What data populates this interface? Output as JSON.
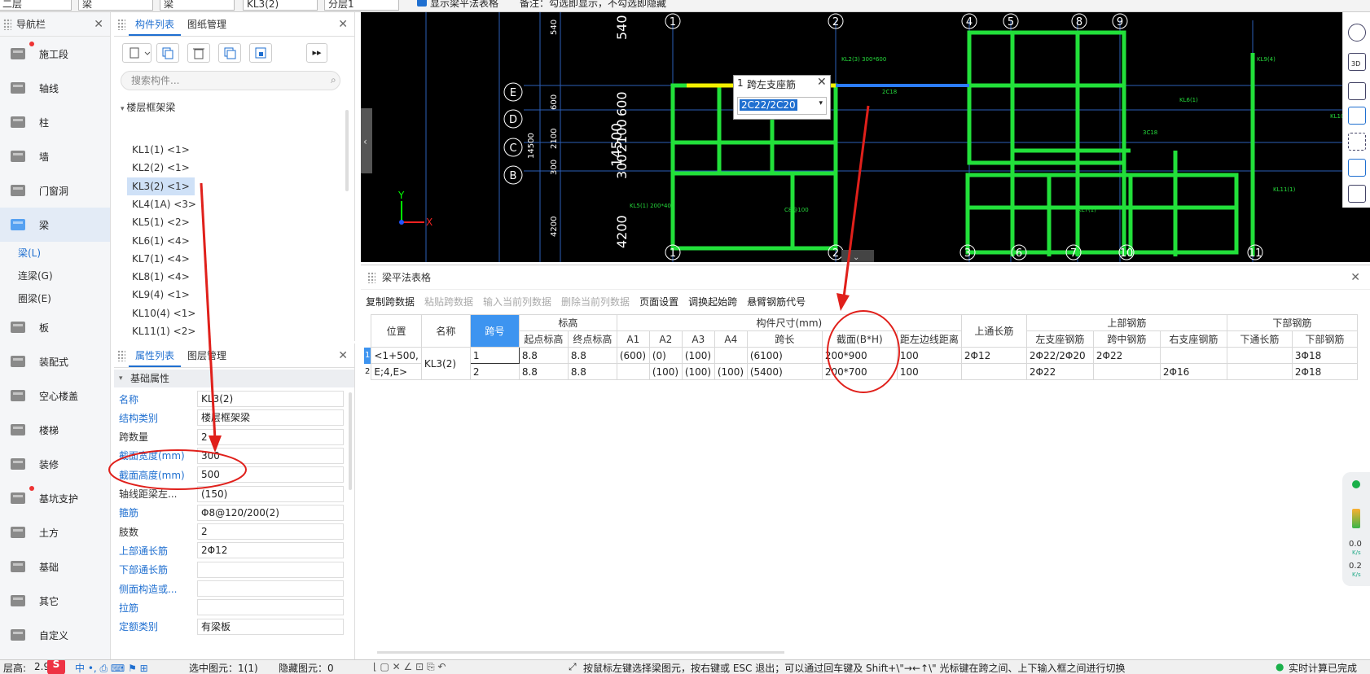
{
  "topbar": {
    "fields": [
      "二层",
      "梁",
      "梁",
      "KL3(2)",
      "分层1"
    ],
    "checkbox": "显示梁平法表格",
    "note": "备注：勾选即显示，不勾选即隐藏"
  },
  "nav": {
    "title": "导航栏",
    "items": [
      {
        "label": "施工段",
        "icon": "construction-icon"
      },
      {
        "label": "轴线",
        "icon": "grid-icon"
      },
      {
        "label": "柱",
        "icon": "column-icon"
      },
      {
        "label": "墙",
        "icon": "wall-icon"
      },
      {
        "label": "门窗洞",
        "icon": "door-window-icon"
      },
      {
        "label": "梁",
        "icon": "beam-icon"
      }
    ],
    "subitems": [
      "梁(L)",
      "连梁(G)",
      "圈梁(E)"
    ],
    "items2": [
      {
        "label": "板",
        "icon": "slab-icon"
      },
      {
        "label": "装配式",
        "icon": "prefab-icon"
      },
      {
        "label": "空心楼盖",
        "icon": "hollow-floor-icon"
      },
      {
        "label": "楼梯",
        "icon": "stairs-icon"
      },
      {
        "label": "装修",
        "icon": "decoration-icon"
      },
      {
        "label": "基坑支护",
        "icon": "pit-support-icon"
      },
      {
        "label": "土方",
        "icon": "earthwork-icon"
      },
      {
        "label": "基础",
        "icon": "foundation-icon"
      },
      {
        "label": "其它",
        "icon": "other-icon"
      },
      {
        "label": "自定义",
        "icon": "custom-icon"
      }
    ]
  },
  "complist": {
    "tabs": [
      "构件列表",
      "图纸管理"
    ],
    "search_placeholder": "搜索构件...",
    "root": "楼层框架梁",
    "items": [
      "KL1(1) <1>",
      "KL2(2) <1>",
      "KL3(2) <1>",
      "KL4(1A) <3>",
      "KL5(1) <2>",
      "KL6(1) <4>",
      "KL7(1) <4>",
      "KL8(1) <4>",
      "KL9(4) <1>",
      "KL10(4) <1>",
      "KL11(1) <2>"
    ]
  },
  "props": {
    "tabs": [
      "属性列表",
      "图层管理"
    ],
    "section": "基础属性",
    "rows": [
      {
        "label": "名称",
        "value": "KL3(2)",
        "blue": true
      },
      {
        "label": "结构类别",
        "value": "楼层框架梁",
        "blue": true
      },
      {
        "label": "跨数量",
        "value": "2",
        "blue": false
      },
      {
        "label": "截面宽度(mm)",
        "value": "300",
        "blue": true
      },
      {
        "label": "截面高度(mm)",
        "value": "500",
        "blue": true
      },
      {
        "label": "轴线距梁左...",
        "value": "(150)",
        "blue": false
      },
      {
        "label": "箍筋",
        "value": "Φ8@120/200(2)",
        "blue": true
      },
      {
        "label": "肢数",
        "value": "2",
        "blue": false
      },
      {
        "label": "上部通长筋",
        "value": "2Φ12",
        "blue": true
      },
      {
        "label": "下部通长筋",
        "value": "",
        "blue": true
      },
      {
        "label": "侧面构造或...",
        "value": "",
        "blue": true
      },
      {
        "label": "拉筋",
        "value": "",
        "blue": true
      },
      {
        "label": "定额类别",
        "value": "有梁板",
        "blue": true
      }
    ]
  },
  "cad": {
    "popup_title": "跨左支座筋",
    "popup_index": "1",
    "popup_value": "2C22/2C20",
    "axis_top": [
      "1",
      "2",
      "4",
      "5",
      "8",
      "9"
    ],
    "axis_bottom": [
      "1",
      "2",
      "3",
      "6",
      "7",
      "10",
      "11"
    ],
    "axis_left": [
      "E",
      "D",
      "C",
      "B"
    ],
    "dims_vertical": [
      "540",
      "600",
      "2100",
      "300",
      "4200",
      "14500"
    ],
    "dims_small": [
      "540",
      "600",
      "2100",
      "300",
      "4200",
      "14500"
    ]
  },
  "table": {
    "title": "梁平法表格",
    "tools": [
      {
        "label": "复制跨数据",
        "enabled": true
      },
      {
        "label": "粘贴跨数据",
        "enabled": false
      },
      {
        "label": "输入当前列数据",
        "enabled": false
      },
      {
        "label": "删除当前列数据",
        "enabled": false
      },
      {
        "label": "页面设置",
        "enabled": true
      },
      {
        "label": "调换起始跨",
        "enabled": true
      },
      {
        "label": "悬臂钢筋代号",
        "enabled": true
      }
    ],
    "headers": {
      "pos": "位置",
      "name": "名称",
      "span": "跨号",
      "elev": "标高",
      "elev_start": "起点标高",
      "elev_end": "终点标高",
      "size": "构件尺寸(mm)",
      "a1": "A1",
      "a2": "A2",
      "a3": "A3",
      "a4": "A4",
      "len": "跨长",
      "sec": "截面(B*H)",
      "dist": "距左边线距离",
      "top_through": "上通长筋",
      "top": "上部钢筋",
      "left_sup": "左支座钢筋",
      "mid": "跨中钢筋",
      "right_sup": "右支座钢筋",
      "bottom": "下部钢筋",
      "bottom_through": "下通长筋",
      "bottom_bar": "下部钢筋"
    },
    "rows": [
      {
        "no": "1",
        "pos": "<1+500,",
        "name": "KL3(2)",
        "span": "1",
        "es": "8.8",
        "ee": "8.8",
        "a1": "(600)",
        "a2": "(0)",
        "a3": "(100)",
        "a4": "",
        "len": "(6100)",
        "sec": "200*900",
        "dist": "100",
        "tt": "2Φ12",
        "ls": "2Φ22/2Φ20",
        "mid": "2Φ22",
        "rs": "",
        "bt": "",
        "bb": "3Φ18"
      },
      {
        "no": "2",
        "pos": "E;4,E>",
        "name": "",
        "span": "2",
        "es": "8.8",
        "ee": "8.8",
        "a1": "",
        "a2": "(100)",
        "a3": "(100)",
        "a4": "(100)",
        "len": "(5400)",
        "sec": "200*700",
        "dist": "100",
        "tt": "",
        "ls": "2Φ22",
        "mid": "",
        "rs": "2Φ16",
        "bt": "",
        "bb": "2Φ18"
      }
    ]
  },
  "status": {
    "floor_label": "层高:",
    "floor_value": "2.9",
    "selected": "选中图元：1(1)",
    "hidden": "隐藏图元：0",
    "hint": "按鼠标左键选择梁图元，按右键或 ESC 退出；可以通过回车键及 Shift+\\\"→←↑\\\" 光标键在跨之间、上下输入框之间进行切换",
    "calc": "实时计算已完成"
  },
  "speed": {
    "up": "0.0",
    "down": "0.2",
    "unit": "K/s"
  },
  "colors": {
    "accent": "#1f6fd0",
    "cad_bg": "#000000",
    "beam_green": "#22e03a",
    "annotation_red": "#e0201b",
    "table_highlight": "#3d94f0"
  }
}
